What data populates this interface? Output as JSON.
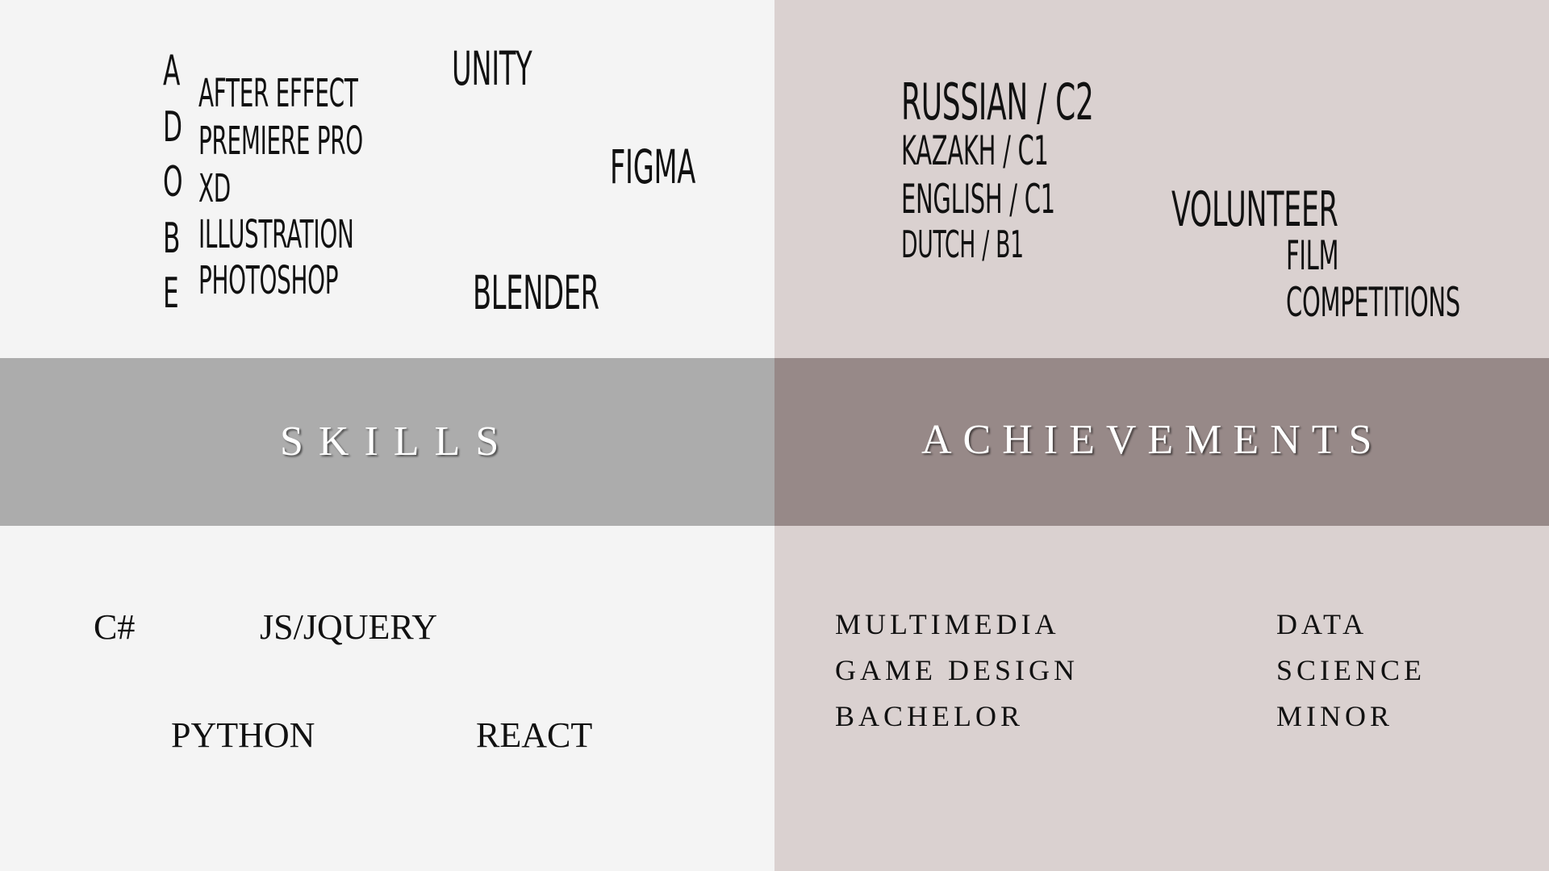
{
  "skills_top": {
    "adobe_letters": [
      "A",
      "D",
      "O",
      "B",
      "E"
    ],
    "adobe_items": [
      "AFTER EFFECT",
      "PREMIERE PRO",
      "XD",
      "ILLUSTRATION",
      "PHOTOSHOP"
    ],
    "unity": "UNITY",
    "figma": "FIGMA",
    "blender": "BLENDER"
  },
  "languages": [
    "RUSSIAN / C2",
    "KAZAKH / C1",
    "ENGLISH / C1",
    "DUTCH / B1"
  ],
  "volunteer": {
    "title": "VOLUNTEER",
    "line1": "FILM",
    "line2": "COMPETITIONS"
  },
  "bands": {
    "skills": "SKILLS",
    "achievements": "ACHIEVEMENTS"
  },
  "programming": {
    "csharp": "C#",
    "js": "JS/JQUERY",
    "python": "PYTHON",
    "react": "REACT"
  },
  "education": {
    "bachelor": [
      "MULTIMEDIA",
      "GAME DESIGN",
      "BACHELOR"
    ],
    "minor": [
      "DATA",
      "SCIENCE",
      "MINOR"
    ]
  },
  "colors": {
    "light_panel": "#f4f4f4",
    "pink_panel": "#dad1d0",
    "gray_band": "#acacac",
    "mauve_band": "#978988"
  }
}
